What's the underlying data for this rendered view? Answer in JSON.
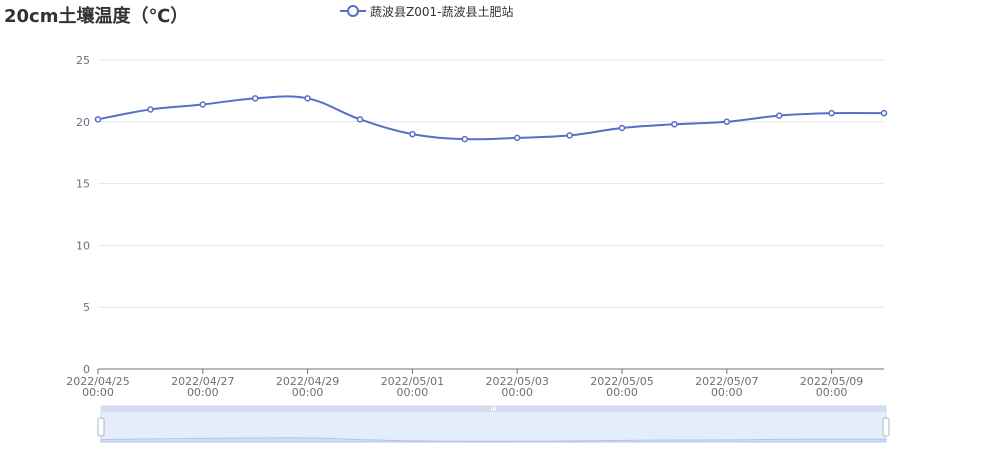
{
  "title": "20cm土壤温度（℃）",
  "legend": {
    "label": "蔬波县Z001-蔬波县土肥站"
  },
  "colors": {
    "series": "#5470c6",
    "grid": "#e0e6f1",
    "axis": "#6e7079",
    "zoom_fill": "#d4ddf7",
    "zoom_window": "#e5ecfb"
  },
  "chart_data": {
    "type": "line",
    "title": "20cm土壤温度（℃）",
    "xlabel": "",
    "ylabel": "",
    "ylim": [
      0,
      25
    ],
    "y_ticks": [
      0,
      5,
      10,
      15,
      20,
      25
    ],
    "x_tick_labels": [
      {
        "date": "2022/04/25",
        "time": "00:00"
      },
      {
        "date": "2022/04/27",
        "time": "00:00"
      },
      {
        "date": "2022/04/29",
        "time": "00:00"
      },
      {
        "date": "2022/05/01",
        "time": "00:00"
      },
      {
        "date": "2022/05/03",
        "time": "00:00"
      },
      {
        "date": "2022/05/05",
        "time": "00:00"
      },
      {
        "date": "2022/05/07",
        "time": "00:00"
      },
      {
        "date": "2022/05/09",
        "time": "00:00"
      }
    ],
    "x": [
      "2022/04/25",
      "2022/04/26",
      "2022/04/27",
      "2022/04/28",
      "2022/04/29",
      "2022/04/30",
      "2022/05/01",
      "2022/05/02",
      "2022/05/03",
      "2022/05/04",
      "2022/05/05",
      "2022/05/06",
      "2022/05/07",
      "2022/05/08",
      "2022/05/09",
      "2022/05/10"
    ],
    "series": [
      {
        "name": "蔬波县Z001-蔬波县土肥站",
        "values": [
          20.2,
          21.0,
          21.4,
          21.9,
          21.9,
          20.2,
          19.0,
          18.6,
          18.7,
          18.9,
          19.5,
          19.8,
          20.0,
          20.5,
          20.7,
          20.7
        ]
      }
    ],
    "grid": true,
    "legend_position": "top-center",
    "data_zoom": {
      "start": 0,
      "end": 100
    }
  }
}
